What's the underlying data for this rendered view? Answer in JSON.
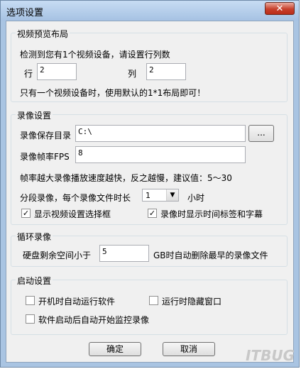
{
  "window": {
    "title": "选项设置",
    "close_glyph": "✕"
  },
  "layout_group": {
    "legend": "视频预览布局",
    "detect_text": "检测到您有1个视频设备，请设置行列数",
    "row_label": "行",
    "row_value": "2",
    "col_label": "列",
    "col_value": "2",
    "note": "只有一个视频设备时，使用默认的1*1布局即可！"
  },
  "record_group": {
    "legend": "录像设置",
    "save_dir_label": "录像保存目录",
    "save_dir_value": "C:\\",
    "browse_label": "...",
    "fps_label": "录像帧率FPS",
    "fps_value": "8",
    "fps_hint": "帧率越大录像播放速度越快，反之越慢，建议值：5～30",
    "segment_label": "分段录像，每个录像文件时长",
    "segment_value": "1",
    "segment_unit": "小时",
    "show_select_label": "显示视频设置选择框",
    "show_select_checked": true,
    "show_timestamp_label": "录像时显示时间标签和字幕",
    "show_timestamp_checked": true
  },
  "loop_group": {
    "legend": "循环录像",
    "disk_label": "硬盘剩余空间小于",
    "disk_value": "5",
    "disk_suffix": "GB时自动删除最早的录像文件"
  },
  "startup_group": {
    "legend": "启动设置",
    "autostart_label": "开机时自动运行软件",
    "autostart_checked": false,
    "hide_label": "运行时隐藏窗口",
    "hide_checked": false,
    "automonitor_label": "软件启动后自动开始监控录像",
    "automonitor_checked": false
  },
  "footer": {
    "ok_label": "确定",
    "cancel_label": "取消"
  },
  "watermark": "ITBUG"
}
